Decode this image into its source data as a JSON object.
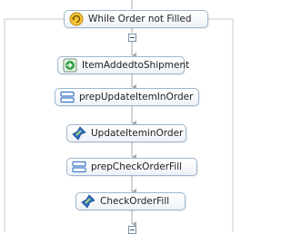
{
  "loop": {
    "label": "While Order not Filled",
    "icon": "while-loop-icon"
  },
  "activities": [
    {
      "label": "ItemAddedtoShipment",
      "icon": "receive-icon"
    },
    {
      "label": "prepUpdateItemInOrder",
      "icon": "assign-icon"
    },
    {
      "label": "UpdateIteminOrder",
      "icon": "invoke-icon"
    },
    {
      "label": "prepCheckOrderFill",
      "icon": "assign-icon"
    },
    {
      "label": "CheckOrderFill",
      "icon": "invoke-icon"
    }
  ],
  "colors": {
    "border": "#9fb6cf",
    "connector": "#a9a9a9",
    "loop_frame": "#c8c8c8",
    "receive_green": "#2f9e3a",
    "assign_blue": "#3e78c2",
    "invoke_blue": "#2e6fc4",
    "loop_yellow": "#f4c430"
  }
}
